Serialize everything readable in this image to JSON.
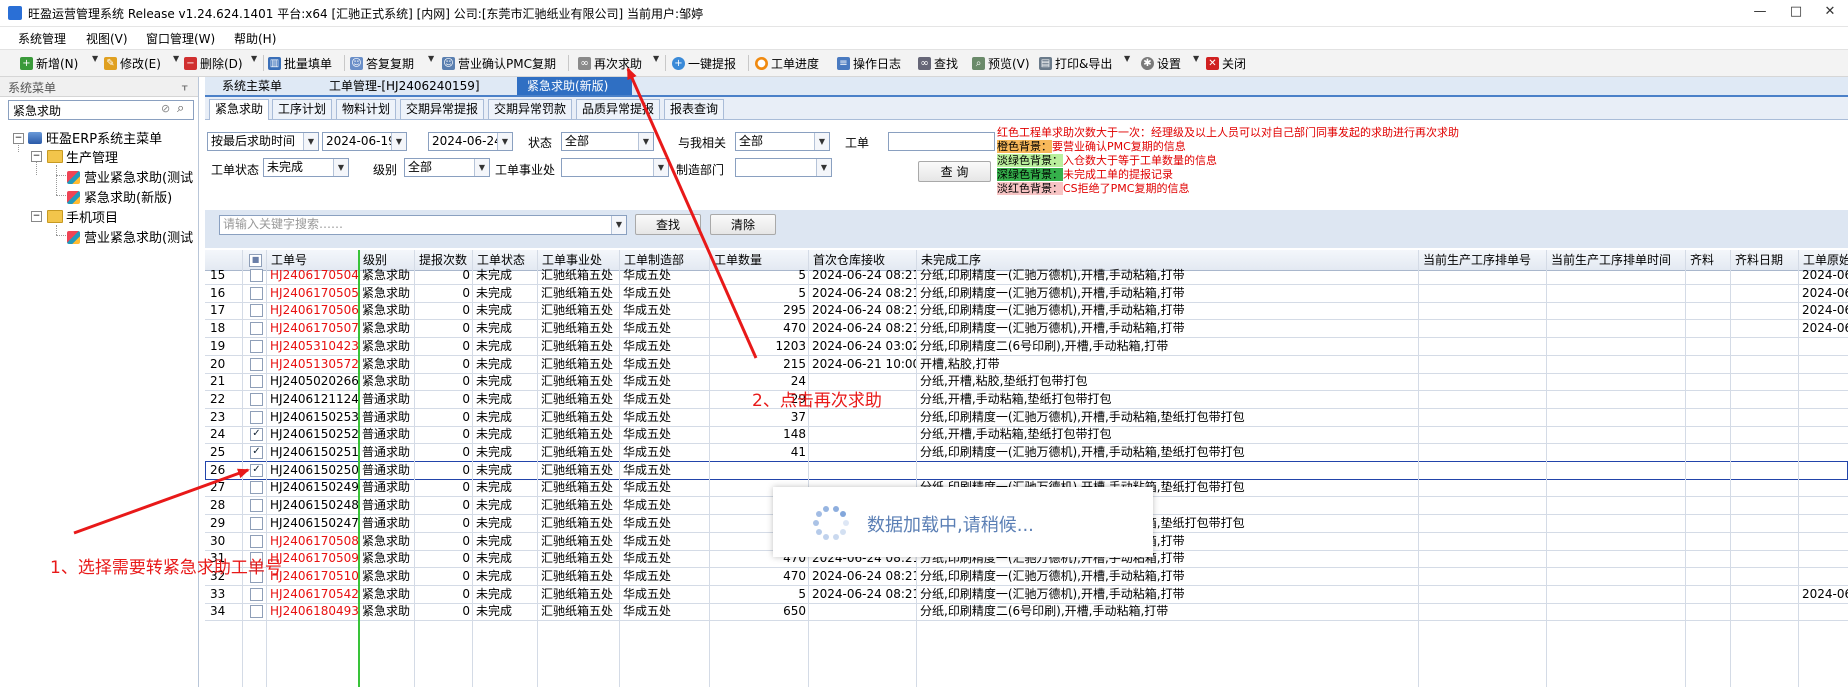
{
  "window": {
    "title": "旺盈运营管理系统 Release v1.24.624.1401 平台:x64  [汇驰正式系统] [内网] 公司:[东莞市汇驰纸业有限公司] 当前用户:邹婷",
    "controls": {
      "minimize": "—",
      "maximize": "□",
      "close": "✕"
    }
  },
  "menu": [
    "系统管理",
    "视图(V)",
    "窗口管理(W)",
    "帮助(H)"
  ],
  "toolbar": {
    "new": "新增(N)",
    "edit": "修改(E)",
    "delete": "删除(D)",
    "batch": "批量填单",
    "reply": "答复复期",
    "pmc": "营业确认PMC复期",
    "rerequest": "再次求助",
    "onekey": "一键提报",
    "progress": "工单进度",
    "log": "操作日志",
    "find": "查找",
    "preview": "预览(V)",
    "print": "打印&导出",
    "settings": "设置",
    "close": "关闭"
  },
  "sidebar": {
    "header": "系统菜单",
    "search_value": "紧急求助",
    "pin": "ᚁ",
    "tree": {
      "root": "旺盈ERP系统主菜单",
      "group1": "生产管理",
      "g1_items": [
        "营业紧急求助(测试",
        "紧急求助(新版)"
      ],
      "group2": "手机项目",
      "g2_items": [
        "营业紧急求助(测试"
      ]
    }
  },
  "doc_tabs": [
    "系统主菜单",
    "工单管理-[HJ2406240159]",
    "紧急求助(新版)"
  ],
  "inner_tabs": [
    "紧急求助",
    "工序计划",
    "物料计划",
    "交期异常提报",
    "交期异常罚款",
    "品质异常提报",
    "报表查询"
  ],
  "filters": {
    "time_mode": "按最后求助时间",
    "date_from": "2024-06-19",
    "date_to": "2024-06-24",
    "status_label": "状态",
    "status_value": "全部",
    "related_label": "与我相关",
    "related_value": "全部",
    "order_label": "工单",
    "order_value": "",
    "order_status_label": "工单状态",
    "order_status_value": "未完成",
    "level_label": "级别",
    "level_value": "全部",
    "division_label": "工单事业处",
    "division_value": "",
    "dept_label": "制造部门",
    "dept_value": "",
    "query_button": "查 询",
    "keyword_placeholder": "请输入关键字搜索……",
    "search_button": "查找",
    "clear_button": "清除"
  },
  "legend": [
    {
      "key": "",
      "text": "红色工程单求助次数大于一次：经理级及以上人员可以对自己部门同事发起的求助进行再次求助",
      "bg": ""
    },
    {
      "key": "橙色背景：",
      "text": "要营业确认PMC复期的信息",
      "bg": "#f7b85a"
    },
    {
      "key": "淡绿色背景：",
      "text": "入仓数大于等于工单数量的信息",
      "bg": "#b9ef9c"
    },
    {
      "key": "深绿色背景：",
      "text": "未完成工单的提报记录",
      "bg": "#35b04b"
    },
    {
      "key": "淡红色背景：",
      "text": "CS拒绝了PMC复期的信息",
      "bg": "#f7c4c4"
    }
  ],
  "grid": {
    "headers": [
      "",
      "",
      "工单号",
      "级别",
      "提报次数",
      "工单状态",
      "工单事业处",
      "工单制造部",
      "工单数量",
      "首次仓库接收",
      "未完成工序",
      "当前生产工序排单号",
      "当前生产工序排单时间",
      "齐料",
      "齐料日期",
      "工单原始"
    ],
    "rows": [
      {
        "n": "15",
        "chk": false,
        "id": "HJ2406170504",
        "red": true,
        "level": "紧急求助",
        "times": "0",
        "status": "未完成",
        "div": "汇驰纸箱五处",
        "dept": "华成五处",
        "qty": "5",
        "first": "2024-06-24 08:21:04",
        "proc": "分纸,印刷精度一(汇驰万德机),开槽,手动粘箱,打带",
        "last": "2024-06"
      },
      {
        "n": "16",
        "chk": false,
        "id": "HJ2406170505",
        "red": true,
        "level": "紧急求助",
        "times": "0",
        "status": "未完成",
        "div": "汇驰纸箱五处",
        "dept": "华成五处",
        "qty": "5",
        "first": "2024-06-24 08:21:04",
        "proc": "分纸,印刷精度一(汇驰万德机),开槽,手动粘箱,打带",
        "last": "2024-06"
      },
      {
        "n": "17",
        "chk": false,
        "id": "HJ2406170506",
        "red": true,
        "level": "紧急求助",
        "times": "0",
        "status": "未完成",
        "div": "汇驰纸箱五处",
        "dept": "华成五处",
        "qty": "295",
        "first": "2024-06-24 08:21:05",
        "proc": "分纸,印刷精度一(汇驰万德机),开槽,手动粘箱,打带",
        "last": "2024-06"
      },
      {
        "n": "18",
        "chk": false,
        "id": "HJ2406170507",
        "red": true,
        "level": "紧急求助",
        "times": "0",
        "status": "未完成",
        "div": "汇驰纸箱五处",
        "dept": "华成五处",
        "qty": "470",
        "first": "2024-06-24 08:21:05",
        "proc": "分纸,印刷精度一(汇驰万德机),开槽,手动粘箱,打带",
        "last": "2024-06"
      },
      {
        "n": "19",
        "chk": false,
        "id": "HJ2405310423",
        "red": true,
        "level": "紧急求助",
        "times": "0",
        "status": "未完成",
        "div": "汇驰纸箱五处",
        "dept": "华成五处",
        "qty": "1203",
        "first": "2024-06-24 03:02:02",
        "proc": "分纸,印刷精度二(6号印刷),开槽,手动粘箱,打带",
        "last": ""
      },
      {
        "n": "20",
        "chk": false,
        "id": "HJ2405130572",
        "red": true,
        "level": "紧急求助",
        "times": "0",
        "status": "未完成",
        "div": "汇驰纸箱五处",
        "dept": "华成五处",
        "qty": "215",
        "first": "2024-06-21 10:00:09",
        "proc": "开槽,粘胶,打带",
        "last": ""
      },
      {
        "n": "21",
        "chk": false,
        "id": "HJ2405020266",
        "red": false,
        "level": "紧急求助",
        "times": "0",
        "status": "未完成",
        "div": "汇驰纸箱五处",
        "dept": "华成五处",
        "qty": "24",
        "first": "",
        "proc": "分纸,开槽,粘胶,垫纸打包带打包",
        "last": ""
      },
      {
        "n": "22",
        "chk": false,
        "id": "HJ2406121124",
        "red": false,
        "level": "普通求助",
        "times": "0",
        "status": "未完成",
        "div": "汇驰纸箱五处",
        "dept": "华成五处",
        "qty": "29",
        "first": "",
        "proc": "分纸,开槽,手动粘箱,垫纸打包带打包",
        "last": ""
      },
      {
        "n": "23",
        "chk": false,
        "id": "HJ2406150253",
        "red": false,
        "level": "普通求助",
        "times": "0",
        "status": "未完成",
        "div": "汇驰纸箱五处",
        "dept": "华成五处",
        "qty": "37",
        "first": "",
        "proc": "分纸,印刷精度一(汇驰万德机),开槽,手动粘箱,垫纸打包带打包",
        "last": ""
      },
      {
        "n": "24",
        "chk": true,
        "id": "HJ2406150252",
        "red": false,
        "level": "普通求助",
        "times": "0",
        "status": "未完成",
        "div": "汇驰纸箱五处",
        "dept": "华成五处",
        "qty": "148",
        "first": "",
        "proc": "分纸,开槽,手动粘箱,垫纸打包带打包",
        "last": ""
      },
      {
        "n": "25",
        "chk": true,
        "id": "HJ2406150251",
        "red": false,
        "level": "普通求助",
        "times": "0",
        "status": "未完成",
        "div": "汇驰纸箱五处",
        "dept": "华成五处",
        "qty": "41",
        "first": "",
        "proc": "分纸,印刷精度一(汇驰万德机),开槽,手动粘箱,垫纸打包带打包",
        "last": ""
      },
      {
        "n": "26",
        "chk": true,
        "id": "HJ2406150250",
        "red": false,
        "level": "普通求助",
        "times": "0",
        "status": "未完成",
        "div": "汇驰纸箱五处",
        "dept": "华成五处",
        "qty": "",
        "first": "",
        "proc": "",
        "last": "",
        "sel": true
      },
      {
        "n": "27",
        "chk": false,
        "id": "HJ2406150249",
        "red": false,
        "level": "普通求助",
        "times": "0",
        "status": "未完成",
        "div": "汇驰纸箱五处",
        "dept": "华成五处",
        "qty": "",
        "first": "",
        "proc": "分纸,印刷精度一(汇驰万德机),开槽,手动粘箱,垫纸打包带打包",
        "last": ""
      },
      {
        "n": "28",
        "chk": false,
        "id": "HJ2406150248",
        "red": false,
        "level": "普通求助",
        "times": "0",
        "status": "未完成",
        "div": "汇驰纸箱五处",
        "dept": "华成五处",
        "qty": "",
        "first": "",
        "proc": "",
        "last": ""
      },
      {
        "n": "29",
        "chk": false,
        "id": "HJ2406150247",
        "red": false,
        "level": "普通求助",
        "times": "0",
        "status": "未完成",
        "div": "汇驰纸箱五处",
        "dept": "华成五处",
        "qty": "21",
        "first": "",
        "proc": "分纸,印刷精度一(汇驰万德机),开槽,手动粘箱,垫纸打包带打包",
        "last": ""
      },
      {
        "n": "30",
        "chk": false,
        "id": "HJ2406170508",
        "red": true,
        "level": "紧急求助",
        "times": "0",
        "status": "未完成",
        "div": "汇驰纸箱五处",
        "dept": "华成五处",
        "qty": "470",
        "first": "2024-06-24 08:21:05",
        "proc": "分纸,印刷精度一(汇驰万德机),开槽,手动粘箱,打带",
        "last": ""
      },
      {
        "n": "31",
        "chk": false,
        "id": "HJ2406170509",
        "red": true,
        "level": "紧急求助",
        "times": "0",
        "status": "未完成",
        "div": "汇驰纸箱五处",
        "dept": "华成五处",
        "qty": "470",
        "first": "2024-06-24 08:21:05",
        "proc": "分纸,印刷精度一(汇驰万德机),开槽,手动粘箱,打带",
        "last": ""
      },
      {
        "n": "32",
        "chk": false,
        "id": "HJ2406170510",
        "red": true,
        "level": "紧急求助",
        "times": "0",
        "status": "未完成",
        "div": "汇驰纸箱五处",
        "dept": "华成五处",
        "qty": "470",
        "first": "2024-06-24 08:21:06",
        "proc": "分纸,印刷精度一(汇驰万德机),开槽,手动粘箱,打带",
        "last": ""
      },
      {
        "n": "33",
        "chk": false,
        "id": "HJ2406170542",
        "red": true,
        "level": "紧急求助",
        "times": "0",
        "status": "未完成",
        "div": "汇驰纸箱五处",
        "dept": "华成五处",
        "qty": "5",
        "first": "2024-06-24 08:21:13",
        "proc": "分纸,印刷精度一(汇驰万德机),开槽,手动粘箱,打带",
        "last": "2024-06"
      },
      {
        "n": "34",
        "chk": false,
        "id": "HJ2406180493",
        "red": true,
        "level": "紧急求助",
        "times": "0",
        "status": "未完成",
        "div": "汇驰纸箱五处",
        "dept": "华成五处",
        "qty": "650",
        "first": "",
        "proc": "分纸,印刷精度二(6号印刷),开槽,手动粘箱,打带",
        "last": ""
      }
    ]
  },
  "loading_text": "数据加载中,请稍候...",
  "annotations": {
    "step1": "1、选择需要转紧急求助工单号",
    "step2": "2、点击再次求助"
  },
  "colors": {
    "accent": "#2f6fc3",
    "annotation": "#e81919",
    "red_text": "#e81010",
    "level_divider": "#39c339"
  }
}
